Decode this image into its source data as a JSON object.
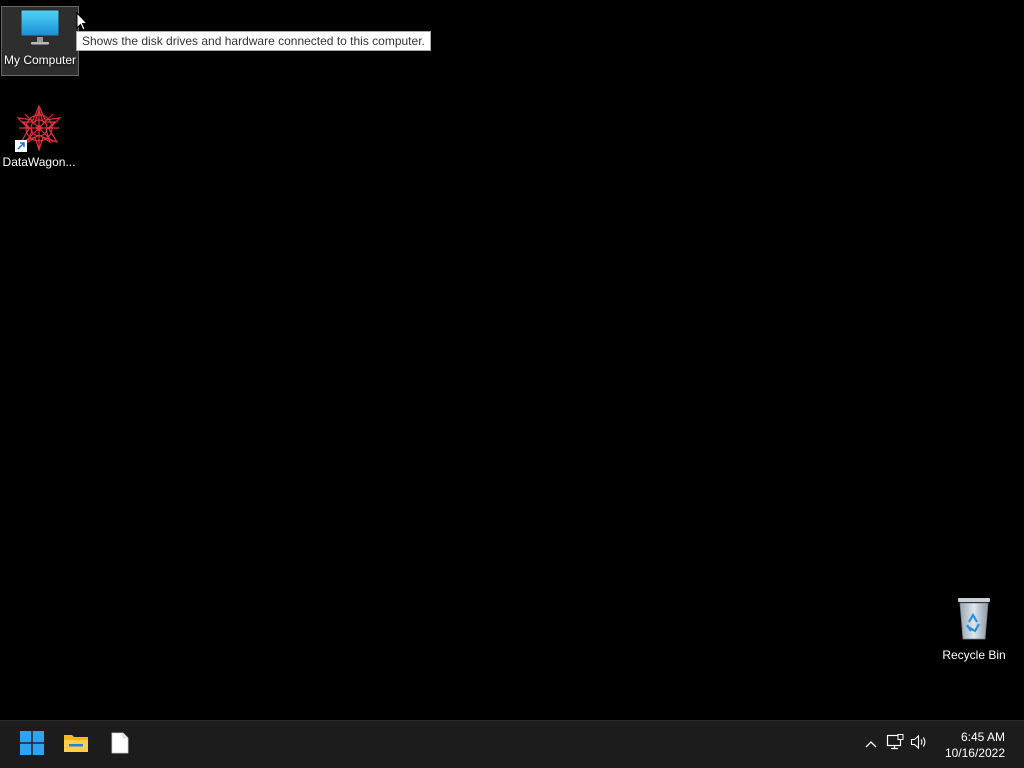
{
  "desktop": {
    "icons": [
      {
        "label": "My Computer",
        "icon": "monitor-icon"
      },
      {
        "label": "DataWagon...",
        "icon": "datawagon-icon"
      },
      {
        "label": "Recycle Bin",
        "icon": "recycle-bin-icon"
      }
    ],
    "tooltip": "Shows the disk drives and hardware connected to this computer."
  },
  "taskbar": {
    "apps": [
      {
        "icon": "windows-start-icon"
      },
      {
        "icon": "file-explorer-icon"
      },
      {
        "icon": "blank-document-icon"
      }
    ],
    "tray": {
      "icons": [
        "chevron-up-icon",
        "network-icon",
        "volume-icon"
      ],
      "time": "6:45 AM",
      "date": "10/16/2022"
    }
  },
  "colors": {
    "background": "#000000",
    "taskbar": "#1c1c1c",
    "accent": "#0078d4"
  }
}
